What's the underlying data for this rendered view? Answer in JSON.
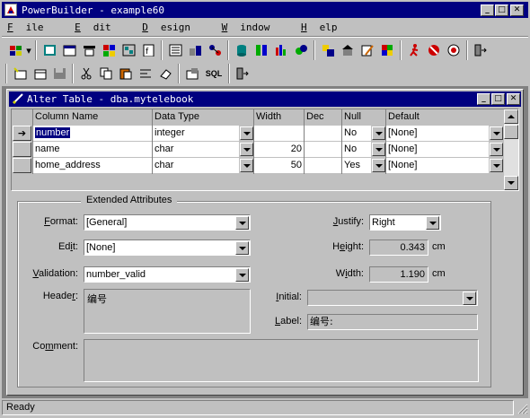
{
  "app": {
    "title": "PowerBuilder - example60",
    "menu": [
      {
        "pre": "",
        "ul": "F",
        "rest": "ile"
      },
      {
        "pre": "",
        "ul": "E",
        "rest": "dit"
      },
      {
        "pre": "",
        "ul": "D",
        "rest": "esign"
      },
      {
        "pre": "",
        "ul": "W",
        "rest": "indow"
      },
      {
        "pre": "",
        "ul": "H",
        "rest": "elp"
      }
    ],
    "toolbar2_sql": "SQL",
    "status": "Ready"
  },
  "child": {
    "title": "Alter Table - dba.mytelebook",
    "columns": [
      "Column Name",
      "Data Type",
      "Width",
      "Dec",
      "Null",
      "Default"
    ],
    "rows": [
      {
        "name": "number",
        "type": "integer",
        "width": "",
        "dec": "",
        "null": "No",
        "default": "[None]"
      },
      {
        "name": "name",
        "type": "char",
        "width": "20",
        "dec": "",
        "null": "No",
        "default": "[None]"
      },
      {
        "name": "home_address",
        "type": "char",
        "width": "50",
        "dec": "",
        "null": "Yes",
        "default": "[None]"
      }
    ],
    "current_row_marker": "➔"
  },
  "ext": {
    "group_title": "Extended Attributes",
    "format": {
      "pre": "",
      "ul": "F",
      "rest": "ormat:",
      "value": "[General]"
    },
    "edit": {
      "pre": "Ed",
      "ul": "i",
      "rest": "t:",
      "value": "[None]"
    },
    "validation": {
      "pre": "",
      "ul": "V",
      "rest": "alidation:",
      "value": "number_valid"
    },
    "header": {
      "pre": "Heade",
      "ul": "r",
      "rest": ":",
      "value": "编号"
    },
    "comment": {
      "pre": "Co",
      "ul": "m",
      "rest": "ment:",
      "value": ""
    },
    "justify": {
      "pre": "",
      "ul": "J",
      "rest": "ustify:",
      "value": "Right"
    },
    "height": {
      "pre": "H",
      "ul": "e",
      "rest": "ight:",
      "value": "0.343",
      "unit": "cm"
    },
    "width": {
      "pre": "W",
      "ul": "i",
      "rest": "dth:",
      "value": "1.190",
      "unit": "cm"
    },
    "initial": {
      "pre": "",
      "ul": "I",
      "rest": "nitial:",
      "value": ""
    },
    "label": {
      "pre": "",
      "ul": "L",
      "rest": "abel:",
      "value": "编号:"
    }
  }
}
